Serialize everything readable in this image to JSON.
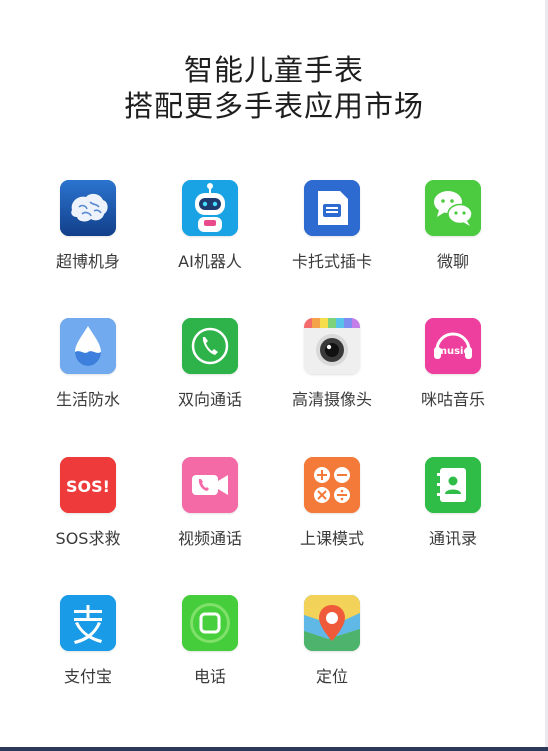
{
  "title": {
    "line1": "智能儿童手表",
    "line2": "搭配更多手表应用市场"
  },
  "apps": [
    {
      "label": "超博机身",
      "icon": "brain-icon",
      "color": "#1d5fb8"
    },
    {
      "label": "AI机器人",
      "icon": "robot-icon",
      "color": "#1aa6e6"
    },
    {
      "label": "卡托式插卡",
      "icon": "sim-card-icon",
      "color": "#2f6fd2"
    },
    {
      "label": "微聊",
      "icon": "chat-icon",
      "color": "#47c93f"
    },
    {
      "label": "生活防水",
      "icon": "water-drop-icon",
      "color": "#6fa9f0"
    },
    {
      "label": "双向通话",
      "icon": "phone-call-icon",
      "color": "#2fb44c"
    },
    {
      "label": "高清摄像头",
      "icon": "camera-icon",
      "color": "#f0f0f0"
    },
    {
      "label": "咪咕音乐",
      "icon": "music-icon",
      "color": "#ef3fa0"
    },
    {
      "label": "SOS求救",
      "icon": "sos-icon",
      "color": "#ef3b3b"
    },
    {
      "label": "视频通话",
      "icon": "video-call-icon",
      "color": "#f56ba8"
    },
    {
      "label": "上课模式",
      "icon": "calculator-icon",
      "color": "#f47a3a"
    },
    {
      "label": "通讯录",
      "icon": "contacts-icon",
      "color": "#2fbe4a"
    },
    {
      "label": "支付宝",
      "icon": "alipay-icon",
      "color": "#1a9ce8"
    },
    {
      "label": "电话",
      "icon": "phone-button-icon",
      "color": "#47cf3d"
    },
    {
      "label": "定位",
      "icon": "location-icon",
      "color": "#3fb37a"
    }
  ]
}
